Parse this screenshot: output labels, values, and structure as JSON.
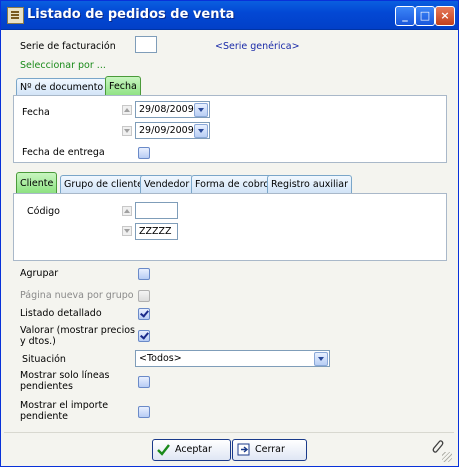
{
  "window": {
    "title": "Listado de pedidos de venta"
  },
  "serie": {
    "label": "Serie de facturación",
    "value": "",
    "hint": "<Serie genérica>"
  },
  "seleccionar": {
    "label": "Seleccionar por ..."
  },
  "sel_tabs": [
    "Nº de documento",
    "Fecha"
  ],
  "fecha": {
    "label": "Fecha",
    "from": "29/08/2009",
    "to": "29/09/2009",
    "entrega_label": "Fecha de entrega"
  },
  "sub_tabs": [
    "Cliente",
    "Grupo de cliente",
    "Vendedor",
    "Forma de cobro",
    "Registro auxiliar"
  ],
  "codigo": {
    "label": "Código",
    "from": "",
    "to": "ZZZZZ"
  },
  "options": {
    "agrupar": {
      "label": "Agrupar",
      "checked": false
    },
    "pagina_nueva": {
      "label": "Página nueva por grupo",
      "checked": false,
      "disabled": true
    },
    "listado": {
      "label": "Listado detallado",
      "checked": true
    },
    "valorar": {
      "label": "Valorar (mostrar precios y dtos.)",
      "checked": true
    },
    "situacion_label": "Situación",
    "situacion_value": "<Todos>",
    "pendientes": {
      "label": "Mostrar solo líneas pendientes",
      "checked": false
    },
    "importe": {
      "label": "Mostrar el importe pendiente",
      "checked": false
    }
  },
  "buttons": {
    "accept": "Aceptar",
    "cancel": "Cerrar"
  },
  "colors": {
    "title_bar": "#0348d4",
    "active_tab": "#8ae07e",
    "link": "#1a2aa8",
    "green_text": "#1a8a1a"
  }
}
